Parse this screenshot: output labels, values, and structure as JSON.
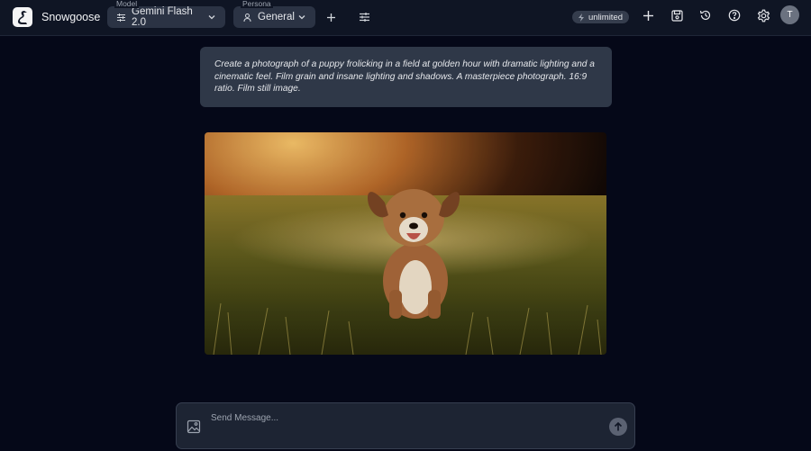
{
  "app": {
    "name": "Snowgoose"
  },
  "header": {
    "model": {
      "caption": "Model",
      "value": "Gemini Flash 2.0"
    },
    "persona": {
      "caption": "Persona",
      "value": "General"
    },
    "usage_badge": "unlimited",
    "avatar_initial": "T"
  },
  "icons": {
    "logo": "goose-logo-icon",
    "model": "sliders-icon",
    "persona": "user-icon",
    "add_persona": "plus-icon",
    "settings_sliders": "sliders-horizontal-icon",
    "bolt": "bolt-icon",
    "new_chat": "plus-icon",
    "save": "save-icon",
    "history": "history-icon",
    "help": "help-icon",
    "settings": "gear-icon",
    "attach_image": "image-icon",
    "send": "arrow-up-icon"
  },
  "conversation": {
    "prompt": "Create a photograph of a puppy frolicking in a field at golden hour with dramatic lighting and a cinematic feel. Film grain and insane lighting and shadows. A masterpiece photograph. 16:9 ratio. Film still image."
  },
  "composer": {
    "placeholder": "Send Message..."
  },
  "colors": {
    "background": "#050818",
    "topbar": "#0f1524",
    "bubble": "#2f3848",
    "composer": "#1d2433"
  }
}
